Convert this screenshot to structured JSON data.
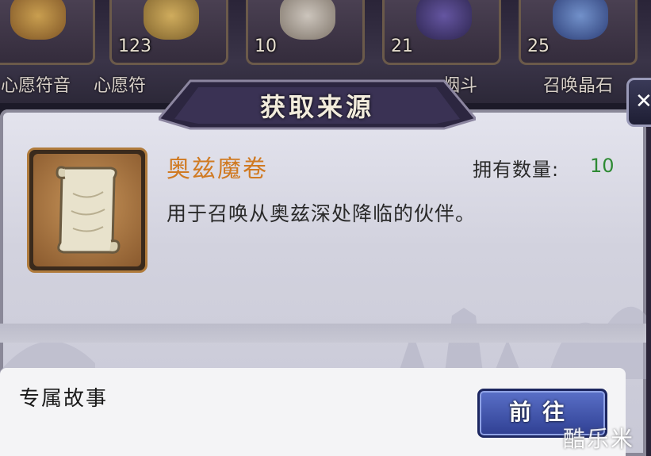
{
  "inventory": {
    "slots": [
      {
        "label": "心愿符音",
        "count": "",
        "icon": "music-note-icon",
        "color": "#c8902e"
      },
      {
        "label": "心愿符",
        "count": "123",
        "icon": "music-note-icon",
        "color": "#d4a848"
      },
      {
        "label": "",
        "count": "10",
        "icon": "scroll-icon",
        "color": "#c8c0b0"
      },
      {
        "label": "烟斗",
        "count": "21",
        "icon": "pipe-icon",
        "color": "#5a4a9a"
      },
      {
        "label": "召唤晶石",
        "count": "25",
        "icon": "crystal-icon",
        "color": "#4a70b0"
      }
    ]
  },
  "dialog": {
    "title": "获取来源",
    "close_icon": "close-icon",
    "item": {
      "icon": "scroll-icon",
      "name": "奥兹魔卷",
      "quantity_label": "拥有数量:",
      "quantity_value": "10",
      "description": "用于召唤从奥兹深处降临的伙伴。"
    },
    "sources": [
      {
        "label": "专属故事",
        "button_label": "前往"
      }
    ]
  },
  "watermark": "酷乐米",
  "colors": {
    "item_name": "#d07a22",
    "quantity": "#2e8a34",
    "go_button": "#3f52a8",
    "panel": "#d6d6e2"
  }
}
